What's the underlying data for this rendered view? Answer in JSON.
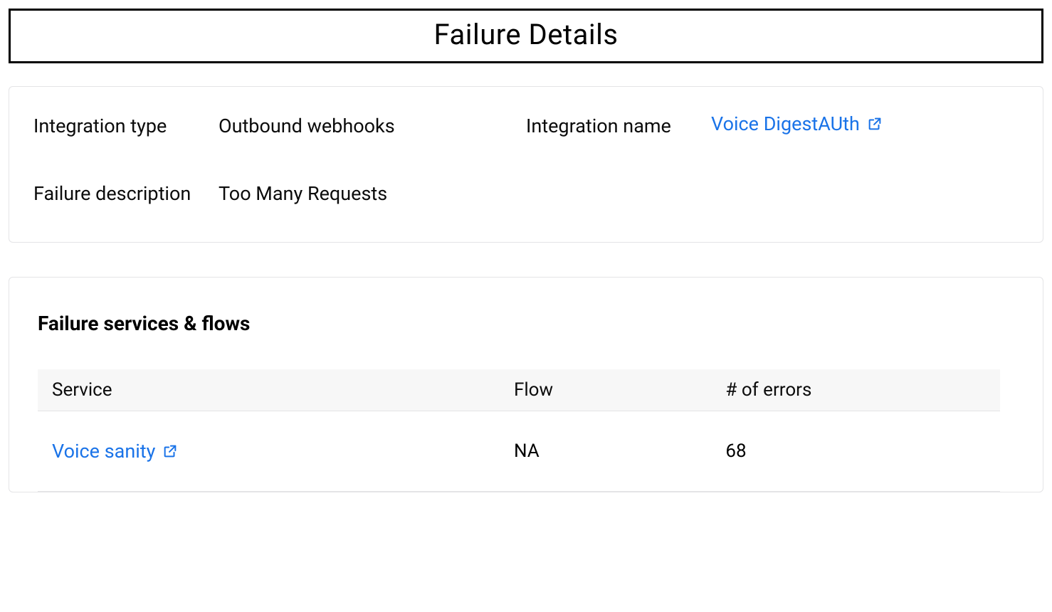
{
  "page": {
    "title": "Failure Details"
  },
  "details": {
    "integration_type_label": "Integration type",
    "integration_type_value": "Outbound webhooks",
    "integration_name_label": "Integration name",
    "integration_name_value": "Voice DigestAUth",
    "failure_desc_label": "Failure description",
    "failure_desc_value": "Too Many Requests"
  },
  "section": {
    "title": "Failure services & flows",
    "columns": {
      "service": "Service",
      "flow": "Flow",
      "errors": "# of errors"
    },
    "rows": [
      {
        "service": "Voice sanity",
        "flow": "NA",
        "errors": "68"
      }
    ]
  }
}
